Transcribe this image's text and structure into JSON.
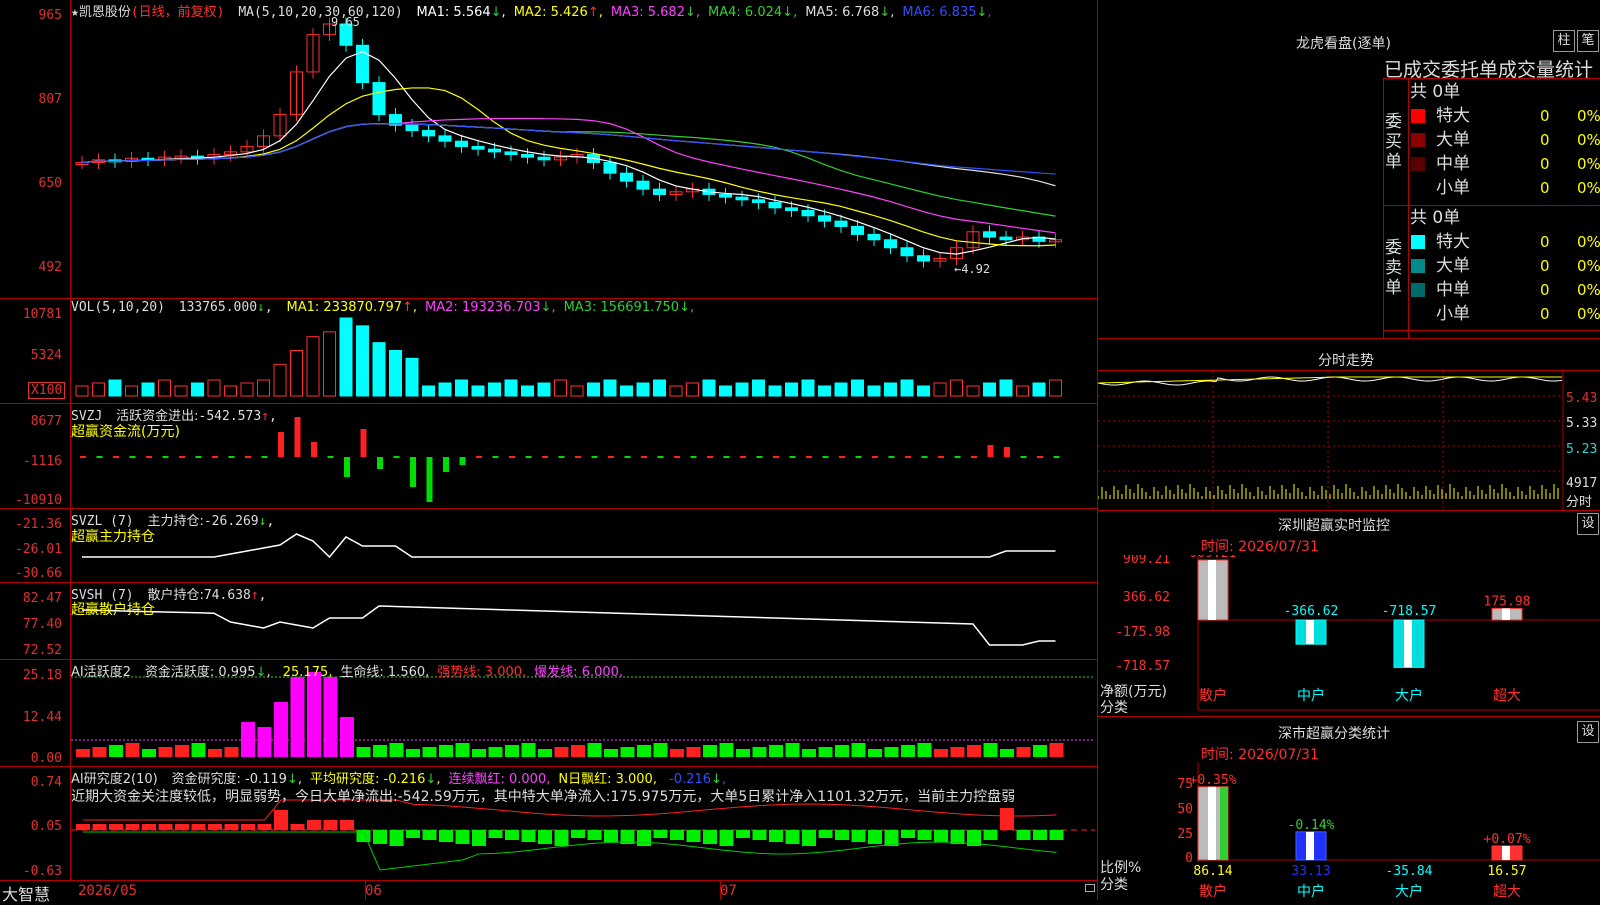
{
  "stock": {
    "name": "★凯恩股份",
    "mode": "(日线，前复权)"
  },
  "main_panel": {
    "ma_spec": "MA(5,10,20,30,60,120)",
    "ma": [
      {
        "label": "MA1:",
        "value": "5.564",
        "arrow": "↓",
        "color": "#ffffff"
      },
      {
        "label": "MA2:",
        "value": "5.426",
        "arrow": "↑",
        "color": "#ffff00"
      },
      {
        "label": "MA3:",
        "value": "5.682",
        "arrow": "↓",
        "color": "#ff40ff"
      },
      {
        "label": "MA4:",
        "value": "6.024",
        "arrow": "↓",
        "color": "#30d030"
      },
      {
        "label": "MA5:",
        "value": "6.768",
        "arrow": "↓",
        "color": "#dddddd"
      },
      {
        "label": "MA6:",
        "value": "6.835",
        "arrow": "↓",
        "color": "#3050ff"
      }
    ],
    "yticks": [
      "965",
      "807",
      "650",
      "492"
    ],
    "high_label": "9.65",
    "low_label": "←4.92"
  },
  "vol_panel": {
    "header": "VOL(5,10,20)",
    "value": "133765.000",
    "value_arrow": "↓",
    "ma": [
      {
        "label": "MA1:",
        "value": "233870.797",
        "arrow": "↑",
        "color": "#ffff00"
      },
      {
        "label": "MA2:",
        "value": "193236.703",
        "arrow": "↓",
        "color": "#ff40ff"
      },
      {
        "label": "MA3:",
        "value": "156691.750",
        "arrow": "↓",
        "color": "#30d030"
      }
    ],
    "yticks": [
      "10781",
      "5324"
    ],
    "unit": "X100"
  },
  "svzj_panel": {
    "header": "SVZJ",
    "label": "活跃资金进出:",
    "value": "-542.573",
    "arrow": "↑",
    "subtitle": "超赢资金流(万元)",
    "yticks": [
      "8677",
      "-1116",
      "-10910"
    ]
  },
  "svzl_panel": {
    "header": "SVZL (7)",
    "label": "主力持仓:",
    "value": "-26.269",
    "arrow": "↓",
    "subtitle": "超赢主力持仓",
    "yticks": [
      "-21.36",
      "-26.01",
      "-30.66"
    ]
  },
  "svsh_panel": {
    "header": "SVSH (7)",
    "label": "散户持仓:",
    "value": "74.638",
    "arrow": "↑",
    "subtitle": "超赢散户持仓",
    "yticks": [
      "82.47",
      "77.40",
      "72.52"
    ]
  },
  "ai_active_panel": {
    "header": "AI活跃度2",
    "items": [
      {
        "label": "资金活跃度:",
        "value": "0.995",
        "arrow": "↓",
        "color": "#dddddd"
      },
      {
        "label": "",
        "value": "25.175",
        "arrow": "",
        "color": "#ffff00"
      },
      {
        "label": "生命线:",
        "value": "1.560",
        "arrow": "",
        "color": "#dddddd"
      },
      {
        "label": "强势线:",
        "value": "3.000",
        "arrow": "",
        "color": "#ff3030"
      },
      {
        "label": "爆发线:",
        "value": "6.000",
        "arrow": "",
        "color": "#ff40ff"
      }
    ],
    "yticks": [
      "25.18",
      "12.44",
      "0.00"
    ]
  },
  "ai_research_panel": {
    "header": "AI研究度2(10)",
    "items": [
      {
        "label": "资金研究度:",
        "value": "-0.119",
        "arrow": "↓",
        "color": "#dddddd"
      },
      {
        "label": "平均研究度:",
        "value": "-0.216",
        "arrow": "↓",
        "color": "#ffff00"
      },
      {
        "label": "连续飘红:",
        "value": "0.000",
        "arrow": "",
        "color": "#ff40ff"
      },
      {
        "label": "N日飘红:",
        "value": "3.000",
        "arrow": "",
        "color": "#ffff00"
      },
      {
        "label": "",
        "value": "-0.216",
        "arrow": "↓",
        "color": "#3050ff"
      }
    ],
    "comment": "近期大资金关注度较低，明显弱势，今日大单净流出:-542.59万元，其中特大单净流入:175.975万元，大单5日累计净入1101.32万元，当前主力控盘弱",
    "yticks": [
      "0.74",
      "0.05",
      "-0.63"
    ]
  },
  "bottom_bar": {
    "brand": "大智慧",
    "dates": [
      "2026/05",
      "06",
      "07"
    ]
  },
  "dragon_panel": {
    "title": "龙虎看盘(逐单)",
    "btn_bar": "柱",
    "btn_pen": "笔",
    "subtitle": "已成交委托单成交量统计",
    "buy": {
      "side_label": "委买单",
      "total": "共 0单",
      "rows": [
        {
          "name": "特大",
          "count": "0",
          "pct": "0%",
          "color": "#ff0000"
        },
        {
          "name": "大单",
          "count": "0",
          "pct": "0%",
          "color": "#8b0000"
        },
        {
          "name": "中单",
          "count": "0",
          "pct": "0%",
          "color": "#5a0000"
        },
        {
          "name": "小单",
          "count": "0",
          "pct": "0%",
          "color": "#000000"
        }
      ]
    },
    "sell": {
      "side_label": "委卖单",
      "total": "共 0单",
      "rows": [
        {
          "name": "特大",
          "count": "0",
          "pct": "0%",
          "color": "#00ffff"
        },
        {
          "name": "大单",
          "count": "0",
          "pct": "0%",
          "color": "#008b8b"
        },
        {
          "name": "中单",
          "count": "0",
          "pct": "0%",
          "color": "#006a6a"
        },
        {
          "name": "小单",
          "count": "0",
          "pct": "0%",
          "color": "#000000"
        }
      ]
    }
  },
  "intraday_panel": {
    "title": "分时走势",
    "yticks": [
      "5.43",
      "5.33",
      "5.23"
    ],
    "vol_tick": "4917",
    "vol_label": "分时"
  },
  "sz_monitor": {
    "title": "深圳超赢实时监控",
    "settings": "设",
    "time": "时间: 2026/07/31",
    "yticks": [
      "909.21",
      "366.62",
      "-175.98",
      "-718.57"
    ],
    "ylabel": "净额(万元)",
    "xlabel": "分类",
    "categories": [
      "散户",
      "中户",
      "大户",
      "超大"
    ],
    "values": [
      909.21,
      -366.62,
      -718.57,
      175.98
    ],
    "value_labels": [
      "909.21",
      "-366.62",
      "-718.57",
      "175.98"
    ]
  },
  "sz_class": {
    "title": "深市超赢分类统计",
    "settings": "设",
    "time": "时间: 2026/07/31",
    "yticks": [
      "75",
      "50",
      "25",
      "0"
    ],
    "ylabel": "比例%",
    "xlabel": "分类",
    "categories": [
      "散户",
      "中户",
      "大户",
      "超大"
    ],
    "top_labels": [
      "+0.35%",
      "-0.14%",
      "",
      "+0.07%"
    ],
    "bottom_labels": [
      "86.14",
      "33.13",
      "-35.84",
      "16.57"
    ],
    "values": [
      86.14,
      33.13,
      0,
      16.57
    ]
  },
  "colors": {
    "up": "#ff3030",
    "down": "#00ffff",
    "grid": "#b00000",
    "axis_text": "#e03030"
  }
}
